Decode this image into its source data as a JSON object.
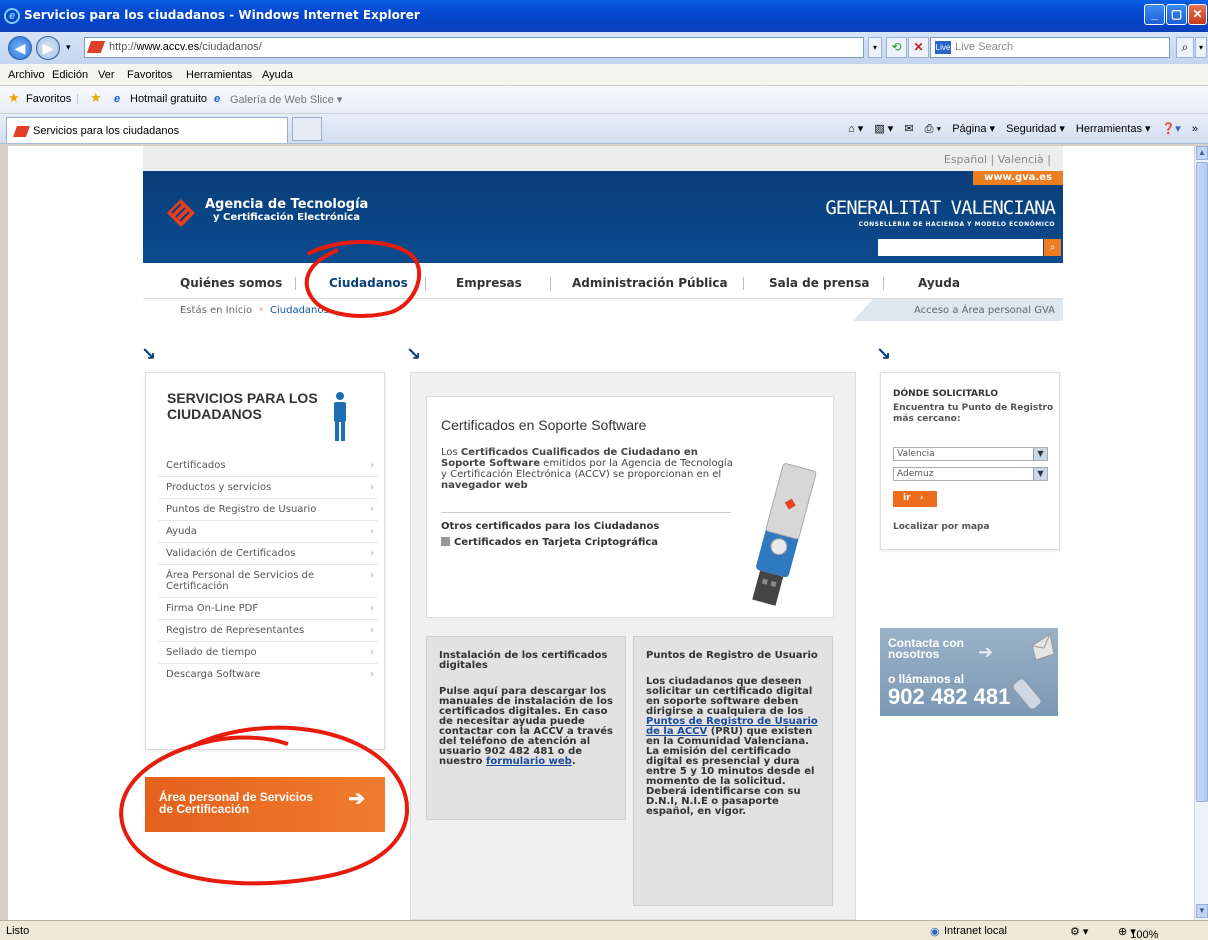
{
  "window": {
    "title": "Servicios para los ciudadanos - Windows Internet Explorer",
    "min": "_",
    "max": "▢",
    "close": "✕"
  },
  "address": {
    "url_prefix": "http://",
    "url_domain": "www.accv.es",
    "url_path": "/ciudadanos/",
    "search_placeholder": "Live Search",
    "search_brand": "Live"
  },
  "menu": [
    "Archivo",
    "Edición",
    "Ver",
    "Favoritos",
    "Herramientas",
    "Ayuda"
  ],
  "favorites": {
    "label": "Favoritos",
    "hotmail": "Hotmail gratuito",
    "webslice": "Galería de Web Slice ▾"
  },
  "tab": {
    "title": "Servicios para los ciudadanos"
  },
  "commandbar": [
    "Página ▾",
    "Seguridad ▾",
    "Herramientas ▾"
  ],
  "site": {
    "lang": "Español | Valencià |",
    "gva_url": "www.gva.es",
    "accv_name": "Agencia de Tecnología",
    "accv_sub": "y Certificación Electrónica",
    "gva_name": "GENERALITAT VALENCIANA",
    "gva_sub": "CONSELLERIA DE HACIENDA Y MODELO ECONÓMICO",
    "nav": [
      "Quiénes somos",
      "Ciudadanos",
      "Empresas",
      "Administración Pública",
      "Sala de prensa",
      "Ayuda"
    ],
    "breadcrumb_prefix": "Estás en Inicio",
    "breadcrumb_current": "Ciudadanos",
    "personal_area": "Acceso a Área personal GVA",
    "left_title": "SERVICIOS PARA LOS CIUDADANOS",
    "left_menu": [
      "Certificados",
      "Productos y servicios",
      "Puntos de Registro de Usuario",
      "Ayuda",
      "Validación de Certificados",
      "Área Personal de Servicios de Certificación",
      "Firma On-Line PDF",
      "Registro de Representantes",
      "Sellado de tiempo",
      "Descarga Software"
    ],
    "area_btn": "Área personal de Servicios de Certificación",
    "cert_title": "Certificados en Soporte Software",
    "cert_p1": "Los ",
    "cert_p1b": "Certificados Cualificados de Ciudadano en Soporte Software",
    "cert_p2": " emitidos por la Agencia de Tecnología y Certificación Electrónica (ACCV) se proporcionan en el ",
    "cert_p2b": "navegador web",
    "cert_other": "Otros certificados para los Ciudadanos",
    "cert_card": "Certificados en Tarjeta Criptográfica",
    "install_title": "Instalación de los certificados digitales",
    "install_body": "Pulse aquí para descargar los manuales de instalación de los certificados digitales. En caso de necesitar ayuda puede contactar con la ACCV a través del teléfono de atención al usuario 902 482 481 o de nuestro ",
    "install_link": "formulario web",
    "pru_title": "Puntos de Registro de Usuario",
    "pru_body1": "Los ciudadanos que deseen solicitar un certificado digital en soporte software deben dirigirse a cualquiera de los ",
    "pru_link": "Puntos de Registro de Usuario de la ACCV",
    "pru_body2": " (PRU) que existen en la Comunidad Valenciana. La emisión del certificado digital es presencial y dura entre 5 y 10 minutos desde el momento de la solicitud. Deberá identificarse con su D.N.I, N.I.E o pasaporte español, en vigor.",
    "where_title": "DÓNDE SOLICITARLO",
    "where_sub": "Encuentra tu Punto de Registro más cercano:",
    "sel_province": "Valencia",
    "sel_town": "Ademuz",
    "go": "ir",
    "map": "Localizar por mapa",
    "contact1": "Contacta con nosotros",
    "contact2": "o llámanos al",
    "phone": "902 482 481"
  },
  "status": {
    "left": "Listo",
    "zone": "Intranet local",
    "zoom": "100%"
  }
}
